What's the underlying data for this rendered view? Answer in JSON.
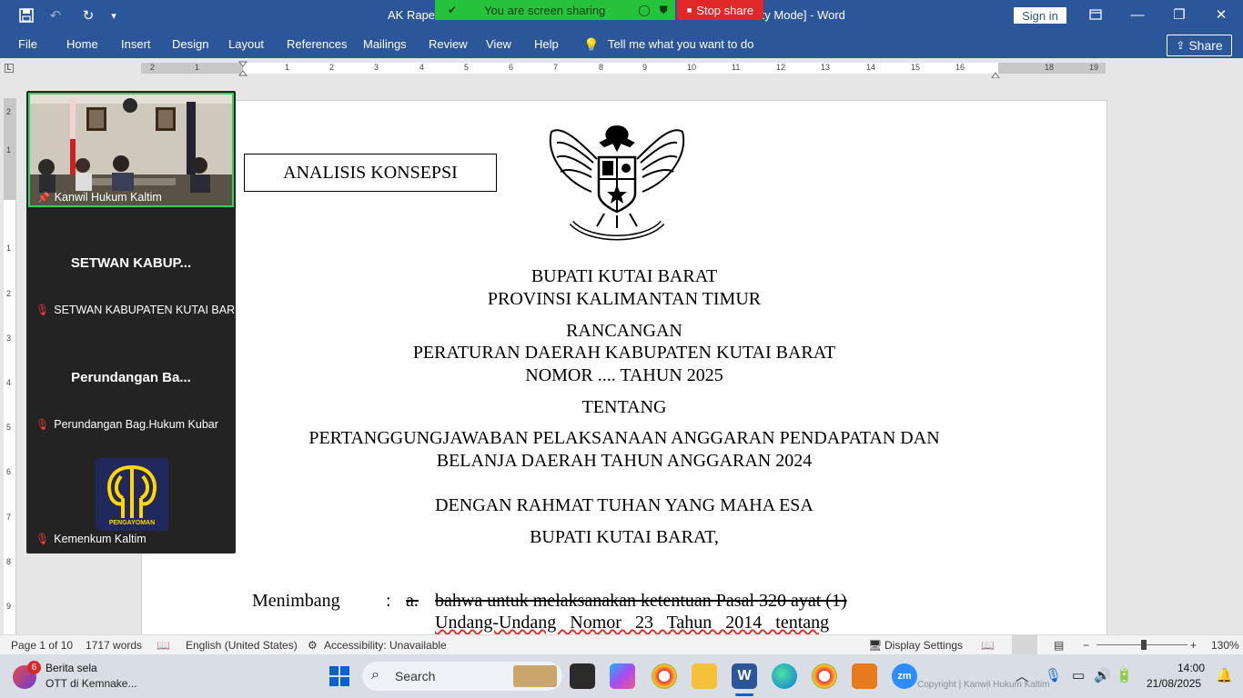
{
  "titlebar": {
    "title_left": "AK Raperd",
    "title_right": "ility Mode]  -  Word",
    "sign_in": "Sign in"
  },
  "share_banner": {
    "text": "You are screen sharing",
    "stop": "Stop share"
  },
  "ribbon": {
    "tabs": [
      "File",
      "Home",
      "Insert",
      "Design",
      "Layout",
      "References",
      "Mailings",
      "Review",
      "View",
      "Help"
    ],
    "tell_me": "Tell me what you want to do",
    "share": "Share"
  },
  "ruler": {
    "h_numbers": [
      "2",
      "1",
      "1",
      "2",
      "3",
      "4",
      "5",
      "6",
      "7",
      "8",
      "9",
      "10",
      "11",
      "12",
      "13",
      "14",
      "15",
      "16",
      "18",
      "19"
    ],
    "v_numbers": [
      "2",
      "1",
      "1",
      "2",
      "3",
      "4",
      "5",
      "6",
      "7",
      "8",
      "9"
    ]
  },
  "video_panel": {
    "participants": [
      {
        "name": "Kanwil Hukum Kaltim"
      },
      {
        "display": "SETWAN KABUP...",
        "name": "SETWAN KABUPATEN KUTAI BAR..."
      },
      {
        "display": "Perundangan Ba...",
        "name": "Perundangan Bag.Hukum Kubar"
      },
      {
        "name": "Kemenkum Kaltim",
        "logo_text": "PENGAYOMAN"
      }
    ]
  },
  "document": {
    "box_label": "ANALISIS KONSEPSI",
    "line1": "BUPATI KUTAI BARAT",
    "line2": "PROVINSI KALIMANTAN TIMUR",
    "line3": "RANCANGAN",
    "line4": "PERATURAN DAERAH KABUPATEN KUTAI BARAT",
    "line5": "NOMOR .... TAHUN 2025",
    "line6": "TENTANG",
    "line7": "PERTANGGUNGJAWABAN PELAKSANAAN ANGGARAN PENDAPATAN DAN",
    "line8": "BELANJA DAERAH TAHUN ANGGARAN 2024",
    "line9": "DENGAN RAHMAT TUHAN YANG MAHA ESA",
    "line10": "BUPATI KUTAI BARAT,",
    "menimbang": "Menimbang",
    "colon": ":",
    "item_a": "a.",
    "clause1": "bahwa untuk melaksanakan ketentuan Pasal 320 ayat (1)",
    "clause2": "Undang-Undang   Nomor   23   Tahun   2014   tentang"
  },
  "statusbar": {
    "page": "Page 1 of 10",
    "words": "1717 words",
    "language": "English (United States)",
    "accessibility": "Accessibility: Unavailable",
    "display_settings": "Display Settings",
    "zoom": "130%"
  },
  "taskbar": {
    "news_badge": "6",
    "news_title": "Berita sela",
    "news_sub": "OTT di Kemnake...",
    "search": "Search",
    "time": "14:00",
    "date": "21/08/2025",
    "watermark": "Copyright | Kanwil Hukum Kaltim"
  },
  "colors": {
    "word_blue": "#2b579a",
    "share_green": "#27c23c",
    "stop_red": "#e02828",
    "video_bg": "#232323"
  }
}
